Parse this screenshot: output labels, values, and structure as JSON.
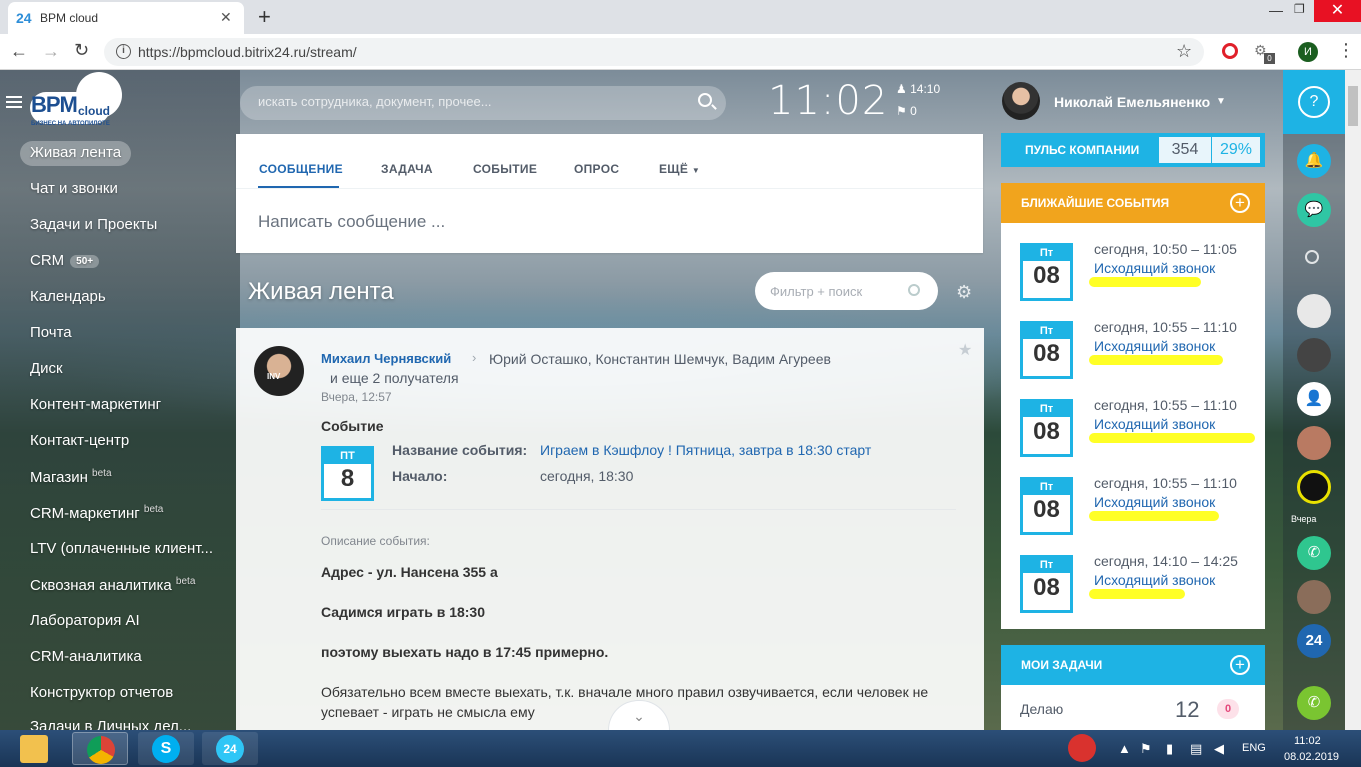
{
  "browser": {
    "tab_title": "BPM cloud",
    "tab_favicon": "24",
    "url": "https://bpmcloud.bitrix24.ru/stream/",
    "profile_initial": "И",
    "ext_badge": "0"
  },
  "logo": {
    "brand": "BPM",
    "cloud": "cloud",
    "tagline": "БИЗНЕС НА АВТОПИЛОТЕ"
  },
  "left_menu": [
    {
      "label": "Живая лента"
    },
    {
      "label": "Чат и звонки"
    },
    {
      "label": "Задачи и Проекты"
    },
    {
      "label": "CRM",
      "badge": "50+"
    },
    {
      "label": "Календарь"
    },
    {
      "label": "Почта"
    },
    {
      "label": "Диск"
    },
    {
      "label": "Контент-маркетинг"
    },
    {
      "label": "Контакт-центр"
    },
    {
      "label": "Магазин",
      "beta": "beta"
    },
    {
      "label": "CRM-маркетинг",
      "beta": "beta"
    },
    {
      "label": "LTV (оплаченные клиент..."
    },
    {
      "label": "Сквозная аналитика",
      "beta": "beta"
    },
    {
      "label": "Лаборатория AI"
    },
    {
      "label": "CRM-аналитика"
    },
    {
      "label": "Конструктор отчетов"
    },
    {
      "label": "Задачи в Личных дел..."
    }
  ],
  "header": {
    "search_placeholder": "искать сотрудника, документ, прочее...",
    "clock": "11:02",
    "work_time": "14:10",
    "counter": "0",
    "user_name": "Николай Емельяненко"
  },
  "composer": {
    "tabs": [
      "СООБЩЕНИЕ",
      "ЗАДАЧА",
      "СОБЫТИЕ",
      "ОПРОС",
      "ЕЩЁ"
    ],
    "placeholder": "Написать сообщение ..."
  },
  "feed": {
    "title": "Живая лента",
    "filter_placeholder": "Фильтр + поиск"
  },
  "post": {
    "author": "Михаил Чернявский",
    "recipients": "Юрий Осташко, Константин Шемчук, Вадим Агуреев",
    "more": "и еще 2 получателя",
    "date": "Вчера, 12:57",
    "avatar_text": "INV",
    "event_heading": "Событие",
    "cal_weekday": "ПТ",
    "cal_day": "8",
    "name_label": "Название события:",
    "name_value": "Играем в Кэшфлоу ! Пятница, завтра в 18:30 старт",
    "start_label": "Начало:",
    "start_value": "сегодня, 18:30",
    "desc_label": "Описание события:",
    "desc_lines": [
      "Адрес - ул. Нансена 355 а",
      "Садимся играть в 18:30",
      "поэтому выехать надо в 17:45 примерно.",
      "Обязательно всем вместе выехать, т.к. вначале много правил озвучивается, если человек не успевает - играть не смысла ему"
    ]
  },
  "pulse": {
    "label": "ПУЛЬС КОМПАНИИ",
    "value": "354",
    "percent": "29%"
  },
  "events": {
    "title": "БЛИЖАЙШИЕ СОБЫТИЯ",
    "items": [
      {
        "weekday": "Пт",
        "day": "08",
        "time": "сегодня, 10:50 – 11:05",
        "title": "Исходящий звонок"
      },
      {
        "weekday": "Пт",
        "day": "08",
        "time": "сегодня, 10:55 – 11:10",
        "title": "Исходящий звонок"
      },
      {
        "weekday": "Пт",
        "day": "08",
        "time": "сегодня, 10:55 – 11:10",
        "title": "Исходящий звонок"
      },
      {
        "weekday": "Пт",
        "day": "08",
        "time": "сегодня, 10:55 – 11:10",
        "title": "Исходящий звонок"
      },
      {
        "weekday": "Пт",
        "day": "08",
        "time": "сегодня, 14:10 – 14:25",
        "title": "Исходящий звонок"
      }
    ],
    "highlight_color": "#ffff00"
  },
  "tasks": {
    "title": "МОИ ЗАДАЧИ",
    "doing_label": "Делаю",
    "doing_count": "12",
    "overdue": "0"
  },
  "right_bar": {
    "yesterday": "Вчера",
    "b24": "24"
  },
  "taskbar": {
    "lang": "ENG",
    "time": "11:02",
    "date": "08.02.2019"
  },
  "colors": {
    "accent": "#1eb3e4",
    "events_header": "#f1a41d",
    "link": "#2067b0"
  }
}
